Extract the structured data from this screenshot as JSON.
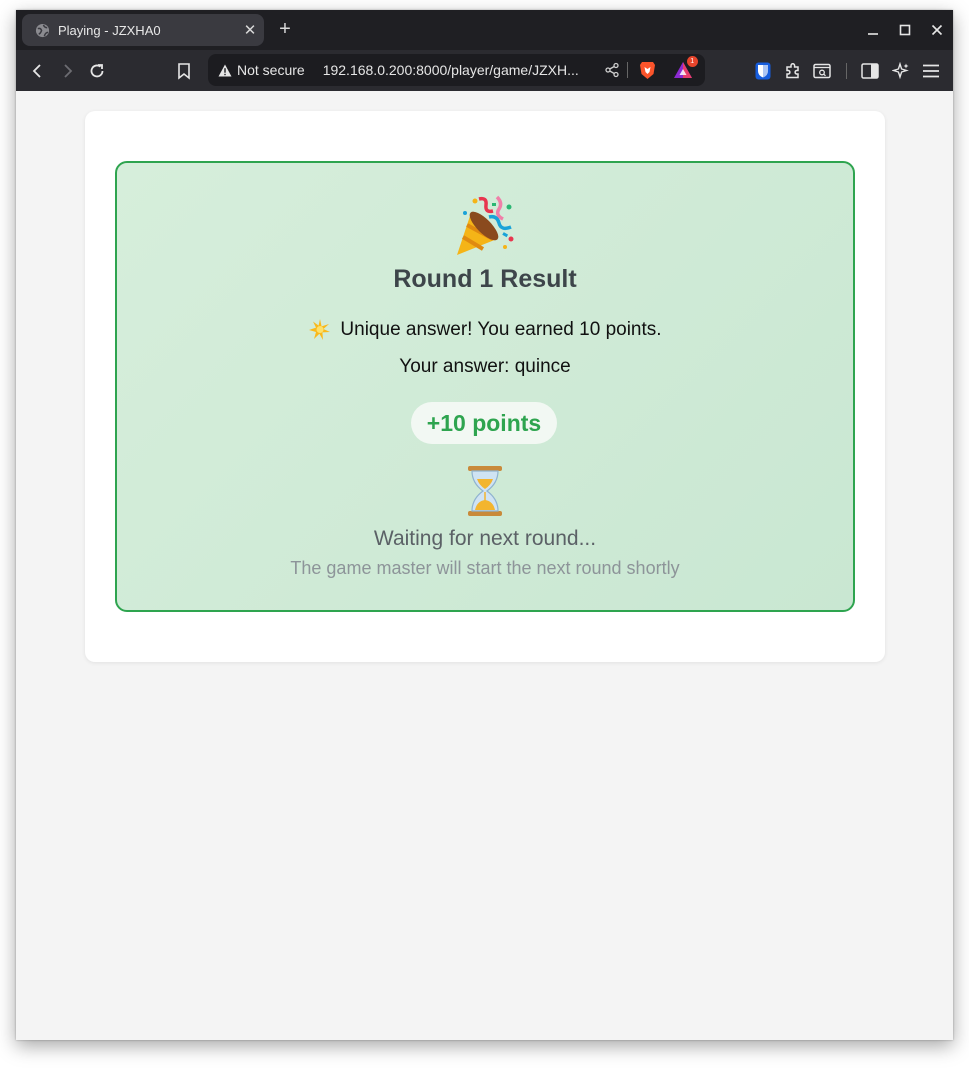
{
  "browser": {
    "tab_title": "Playing - JZXHA0",
    "security_label": "Not secure",
    "url": "192.168.0.200:8000/player/game/JZXH...",
    "rewards_badge": "1"
  },
  "result": {
    "title": "Round 1 Result",
    "message": "Unique answer! You earned 10 points.",
    "answer_line": "Your answer: quince",
    "points": "+10 points",
    "waiting": "Waiting for next round...",
    "waiting_sub": "The game master will start the next round shortly"
  },
  "colors": {
    "accent_green": "#2ea44f",
    "result_bg": "#d2ebd9"
  }
}
